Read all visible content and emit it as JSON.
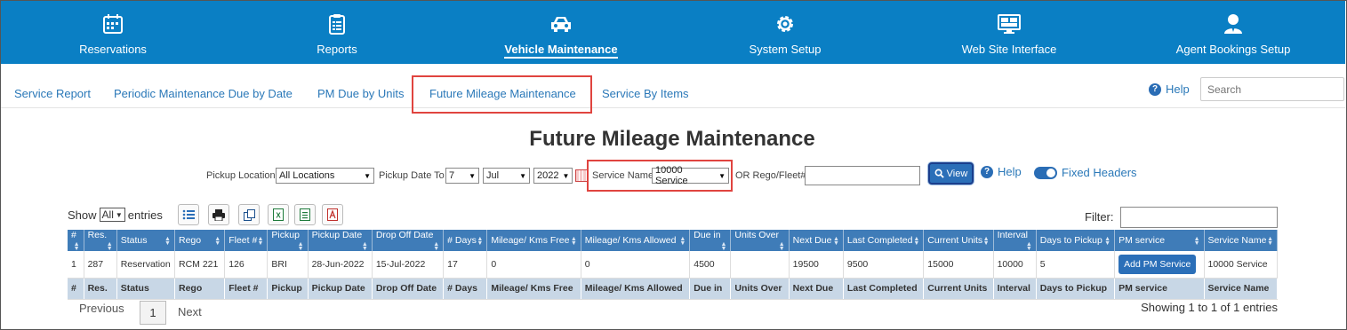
{
  "topnav": [
    {
      "label": "Reservations",
      "icon": "calendar-icon",
      "active": false
    },
    {
      "label": "Reports",
      "icon": "clipboard-icon",
      "active": false
    },
    {
      "label": "Vehicle Maintenance",
      "icon": "car-icon",
      "active": true
    },
    {
      "label": "System Setup",
      "icon": "gear-icon",
      "active": false
    },
    {
      "label": "Web Site Interface",
      "icon": "monitor-icon",
      "active": false
    },
    {
      "label": "Agent Bookings Setup",
      "icon": "user-icon",
      "active": false
    }
  ],
  "subnav": {
    "tabs": [
      "Service Report",
      "Periodic Maintenance Due by Date",
      "PM Due by Units",
      "Future Mileage Maintenance",
      "Service By Items"
    ],
    "help": "Help",
    "search_placeholder": "Search"
  },
  "page_title": "Future Mileage Maintenance",
  "filters": {
    "pickup_location_label": "Pickup Location",
    "pickup_location_value": "All Locations",
    "pickup_date_to_label": "Pickup Date To",
    "day": "7",
    "month": "Jul",
    "year": "2022",
    "service_name_label": "Service Name",
    "service_name_value": "10000 Service",
    "rego_label": "OR Rego/Fleet#",
    "view_label": "View",
    "help_label": "Help",
    "fixed_headers_label": "Fixed Headers"
  },
  "table_controls": {
    "show_label": "Show",
    "show_value": "All",
    "entries_label": "entries",
    "filter_label": "Filter:"
  },
  "table": {
    "columns": [
      "#",
      "Res.",
      "Status",
      "Rego",
      "Fleet #",
      "Pickup",
      "Pickup Date",
      "Drop Off Date",
      "# Days",
      "Mileage/ Kms Free",
      "Mileage/ Kms Allowed",
      "Due in",
      "Units Over",
      "Next Due",
      "Last Completed",
      "Current Units",
      "Interval",
      "Days to Pickup",
      "PM service",
      "Service Name"
    ],
    "rows": [
      {
        "num": "1",
        "res": "287",
        "status": "Reservation",
        "rego": "RCM 221",
        "fleet": "126",
        "pickup": "BRI",
        "pickup_date": "28-Jun-2022",
        "dropoff_date": "15-Jul-2022",
        "days": "17",
        "kms_free": "0",
        "kms_allowed": "0",
        "due_in": "4500",
        "units_over": "",
        "next_due": "19500",
        "last_completed": "9500",
        "current_units": "15000",
        "interval": "10000",
        "days_to_pickup": "5",
        "pm_button": "Add PM Service",
        "service_name": "10000 Service"
      }
    ]
  },
  "pagination": {
    "previous": "Previous",
    "page": "1",
    "next": "Next",
    "info": "Showing 1 to 1 of 1 entries"
  },
  "colors": {
    "nav_bg": "#0a7fc4",
    "header_bg": "#3f7cb8",
    "highlight": "#e0443f",
    "footer_bg": "#c8d7e6"
  }
}
